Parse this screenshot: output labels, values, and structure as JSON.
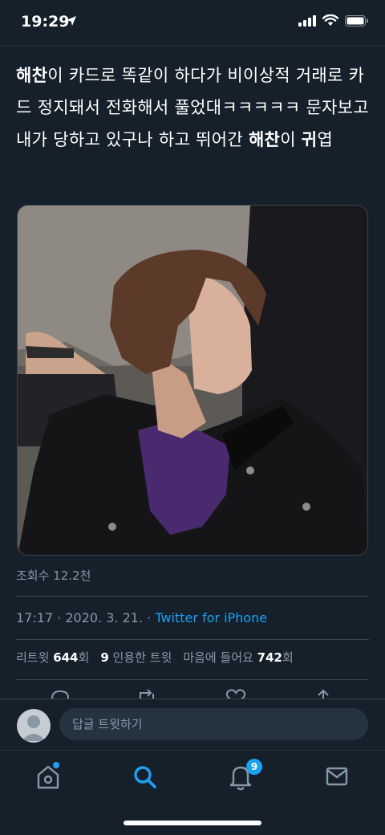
{
  "status_bar": {
    "time": "19:29"
  },
  "tweet": {
    "text_parts": [
      {
        "t": "해찬",
        "bold": true
      },
      {
        "t": "이 카드로 똑같이 하다가 비이상적 거래로 카드 정지돼서 전화해서 풀었대ㅋㅋㅋㅋㅋ 문자보고 내가 당하고 있구나 하고 뛰어간 ",
        "bold": false
      },
      {
        "t": "해찬",
        "bold": true
      },
      {
        "t": "이 ",
        "bold": false
      },
      {
        "t": "귀",
        "bold": true
      },
      {
        "t": "엽",
        "bold": false
      }
    ],
    "views": "조회수 12.2천",
    "timestamp": "17:17 · 2020. 3. 21. ·",
    "source": "Twitter for iPhone",
    "stats": {
      "retweets_label": "리트윗",
      "retweets_count": "644",
      "retweets_unit": "회",
      "quotes_count": "9",
      "quotes_label": "인용한 트윗",
      "likes_label": "마음에 들어요",
      "likes_count": "742",
      "likes_unit": "회"
    }
  },
  "reply": {
    "placeholder": "답글 트윗하기"
  },
  "tabbar": {
    "notifications_badge": "9"
  },
  "colors": {
    "background": "#15202b",
    "accent": "#1da1f2",
    "muted": "#8899a6",
    "border": "#38444d"
  }
}
